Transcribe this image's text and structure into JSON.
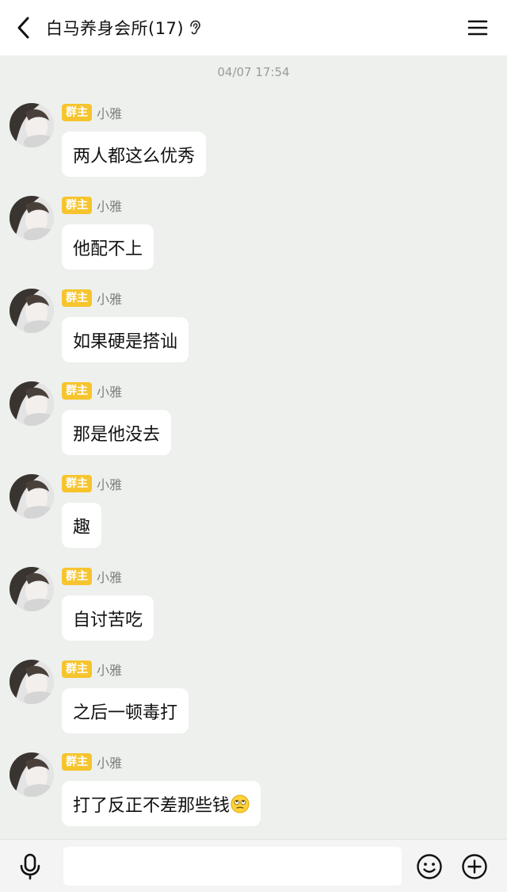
{
  "header": {
    "title": "白马养身会所(17)",
    "back_icon": "chevron-left-icon",
    "ear_icon": "ear-icon",
    "menu_icon": "hamburger-menu-icon"
  },
  "chat": {
    "timestamp": "04/07 17:54",
    "messages": [
      {
        "badge": "群主",
        "sender": "小雅",
        "text": "两人都这么优秀"
      },
      {
        "badge": "群主",
        "sender": "小雅",
        "text": "他配不上"
      },
      {
        "badge": "群主",
        "sender": "小雅",
        "text": "如果硬是搭讪"
      },
      {
        "badge": "群主",
        "sender": "小雅",
        "text": "那是他没去"
      },
      {
        "badge": "群主",
        "sender": "小雅",
        "text": "趣"
      },
      {
        "badge": "群主",
        "sender": "小雅",
        "text": "自讨苦吃"
      },
      {
        "badge": "群主",
        "sender": "小雅",
        "text": "之后一顿毒打"
      },
      {
        "badge": "群主",
        "sender": "小雅",
        "text": "打了反正不差那些钱",
        "emoji": "eye-roll-emoji"
      }
    ]
  },
  "footer": {
    "voice_icon": "microphone-icon",
    "input_value": "",
    "emoji_icon": "smiley-icon",
    "plus_icon": "plus-circle-icon"
  },
  "colors": {
    "badge": "#f6c42d",
    "chat_bg": "#edf0ec",
    "bubble": "#ffffff"
  }
}
